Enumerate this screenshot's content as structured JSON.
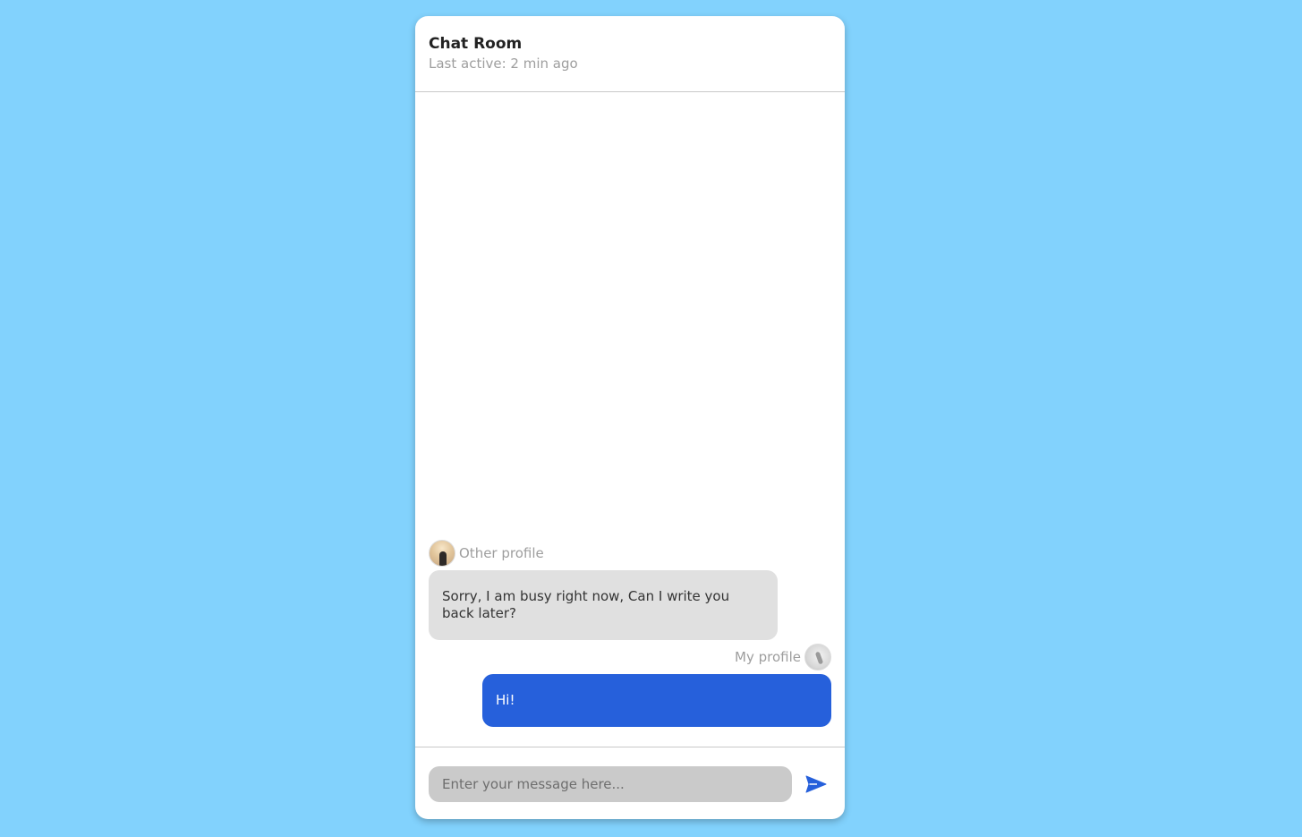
{
  "header": {
    "title": "Chat Room",
    "subtitle": "Last active: 2 min ago"
  },
  "messages": [
    {
      "sender": "Other profile",
      "avatar": "other-profile-avatar",
      "text": "Sorry, I am busy right now, Can I write you back later?",
      "direction": "incoming"
    },
    {
      "sender": "My profile",
      "avatar": "my-profile-avatar",
      "text": "Hi!",
      "direction": "outgoing"
    }
  ],
  "composer": {
    "placeholder": "Enter your message here...",
    "value": "",
    "send_icon": "send-icon"
  },
  "colors": {
    "background": "#82d2fd",
    "outgoing_bubble": "#2660db",
    "incoming_bubble": "#e0e0e0",
    "input_background": "#cacaca",
    "send_icon": "#2660db"
  }
}
